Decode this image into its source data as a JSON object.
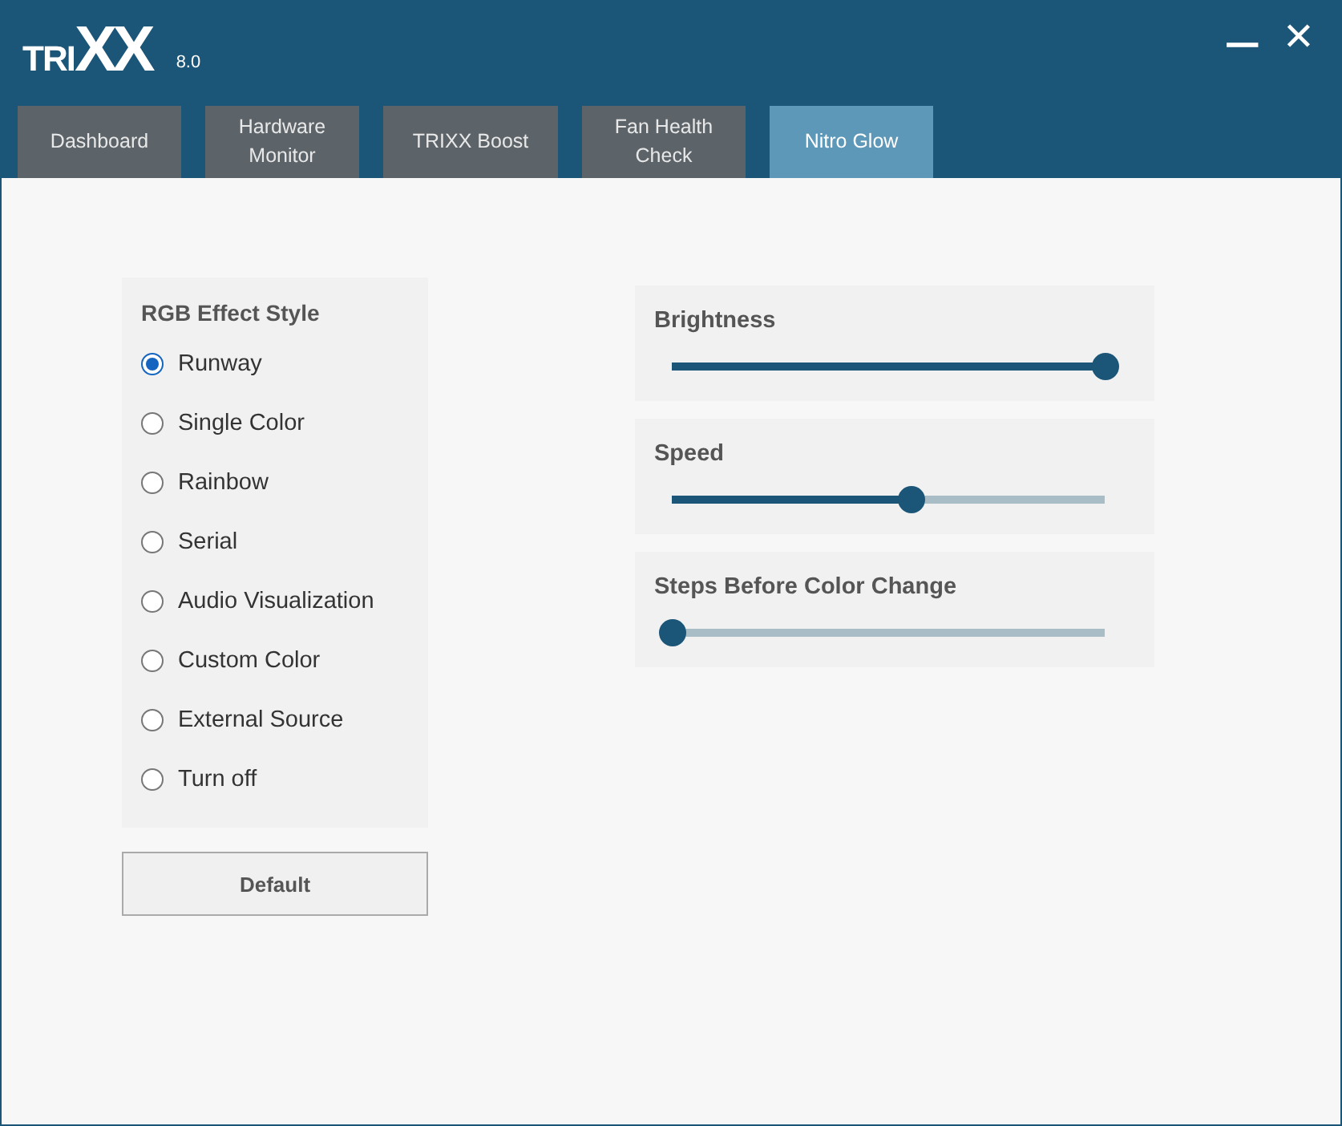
{
  "window": {
    "logo_prefix": "TRI",
    "logo_mark": "XX",
    "version": "8.0",
    "minimize": "—",
    "close": "✕"
  },
  "tabs": [
    {
      "label": "Dashboard",
      "selected": false
    },
    {
      "label": "Hardware Monitor",
      "selected": false
    },
    {
      "label": "TRIXX Boost",
      "selected": false
    },
    {
      "label": "Fan Health Check",
      "selected": false
    },
    {
      "label": "Nitro Glow",
      "selected": true
    }
  ],
  "effect_style": {
    "title": "RGB Effect Style",
    "options": [
      {
        "label": "Runway",
        "selected": true
      },
      {
        "label": "Single Color",
        "selected": false
      },
      {
        "label": "Rainbow",
        "selected": false
      },
      {
        "label": "Serial",
        "selected": false
      },
      {
        "label": "Audio Visualization",
        "selected": false
      },
      {
        "label": "Custom Color",
        "selected": false
      },
      {
        "label": "External Source",
        "selected": false
      },
      {
        "label": "Turn off",
        "selected": false
      }
    ]
  },
  "default_button": "Default",
  "sliders": [
    {
      "label": "Brightness",
      "level": 1
    },
    {
      "label": "Speed",
      "level": 0.55
    },
    {
      "label": "Steps Before Color Change",
      "level": 0
    }
  ]
}
